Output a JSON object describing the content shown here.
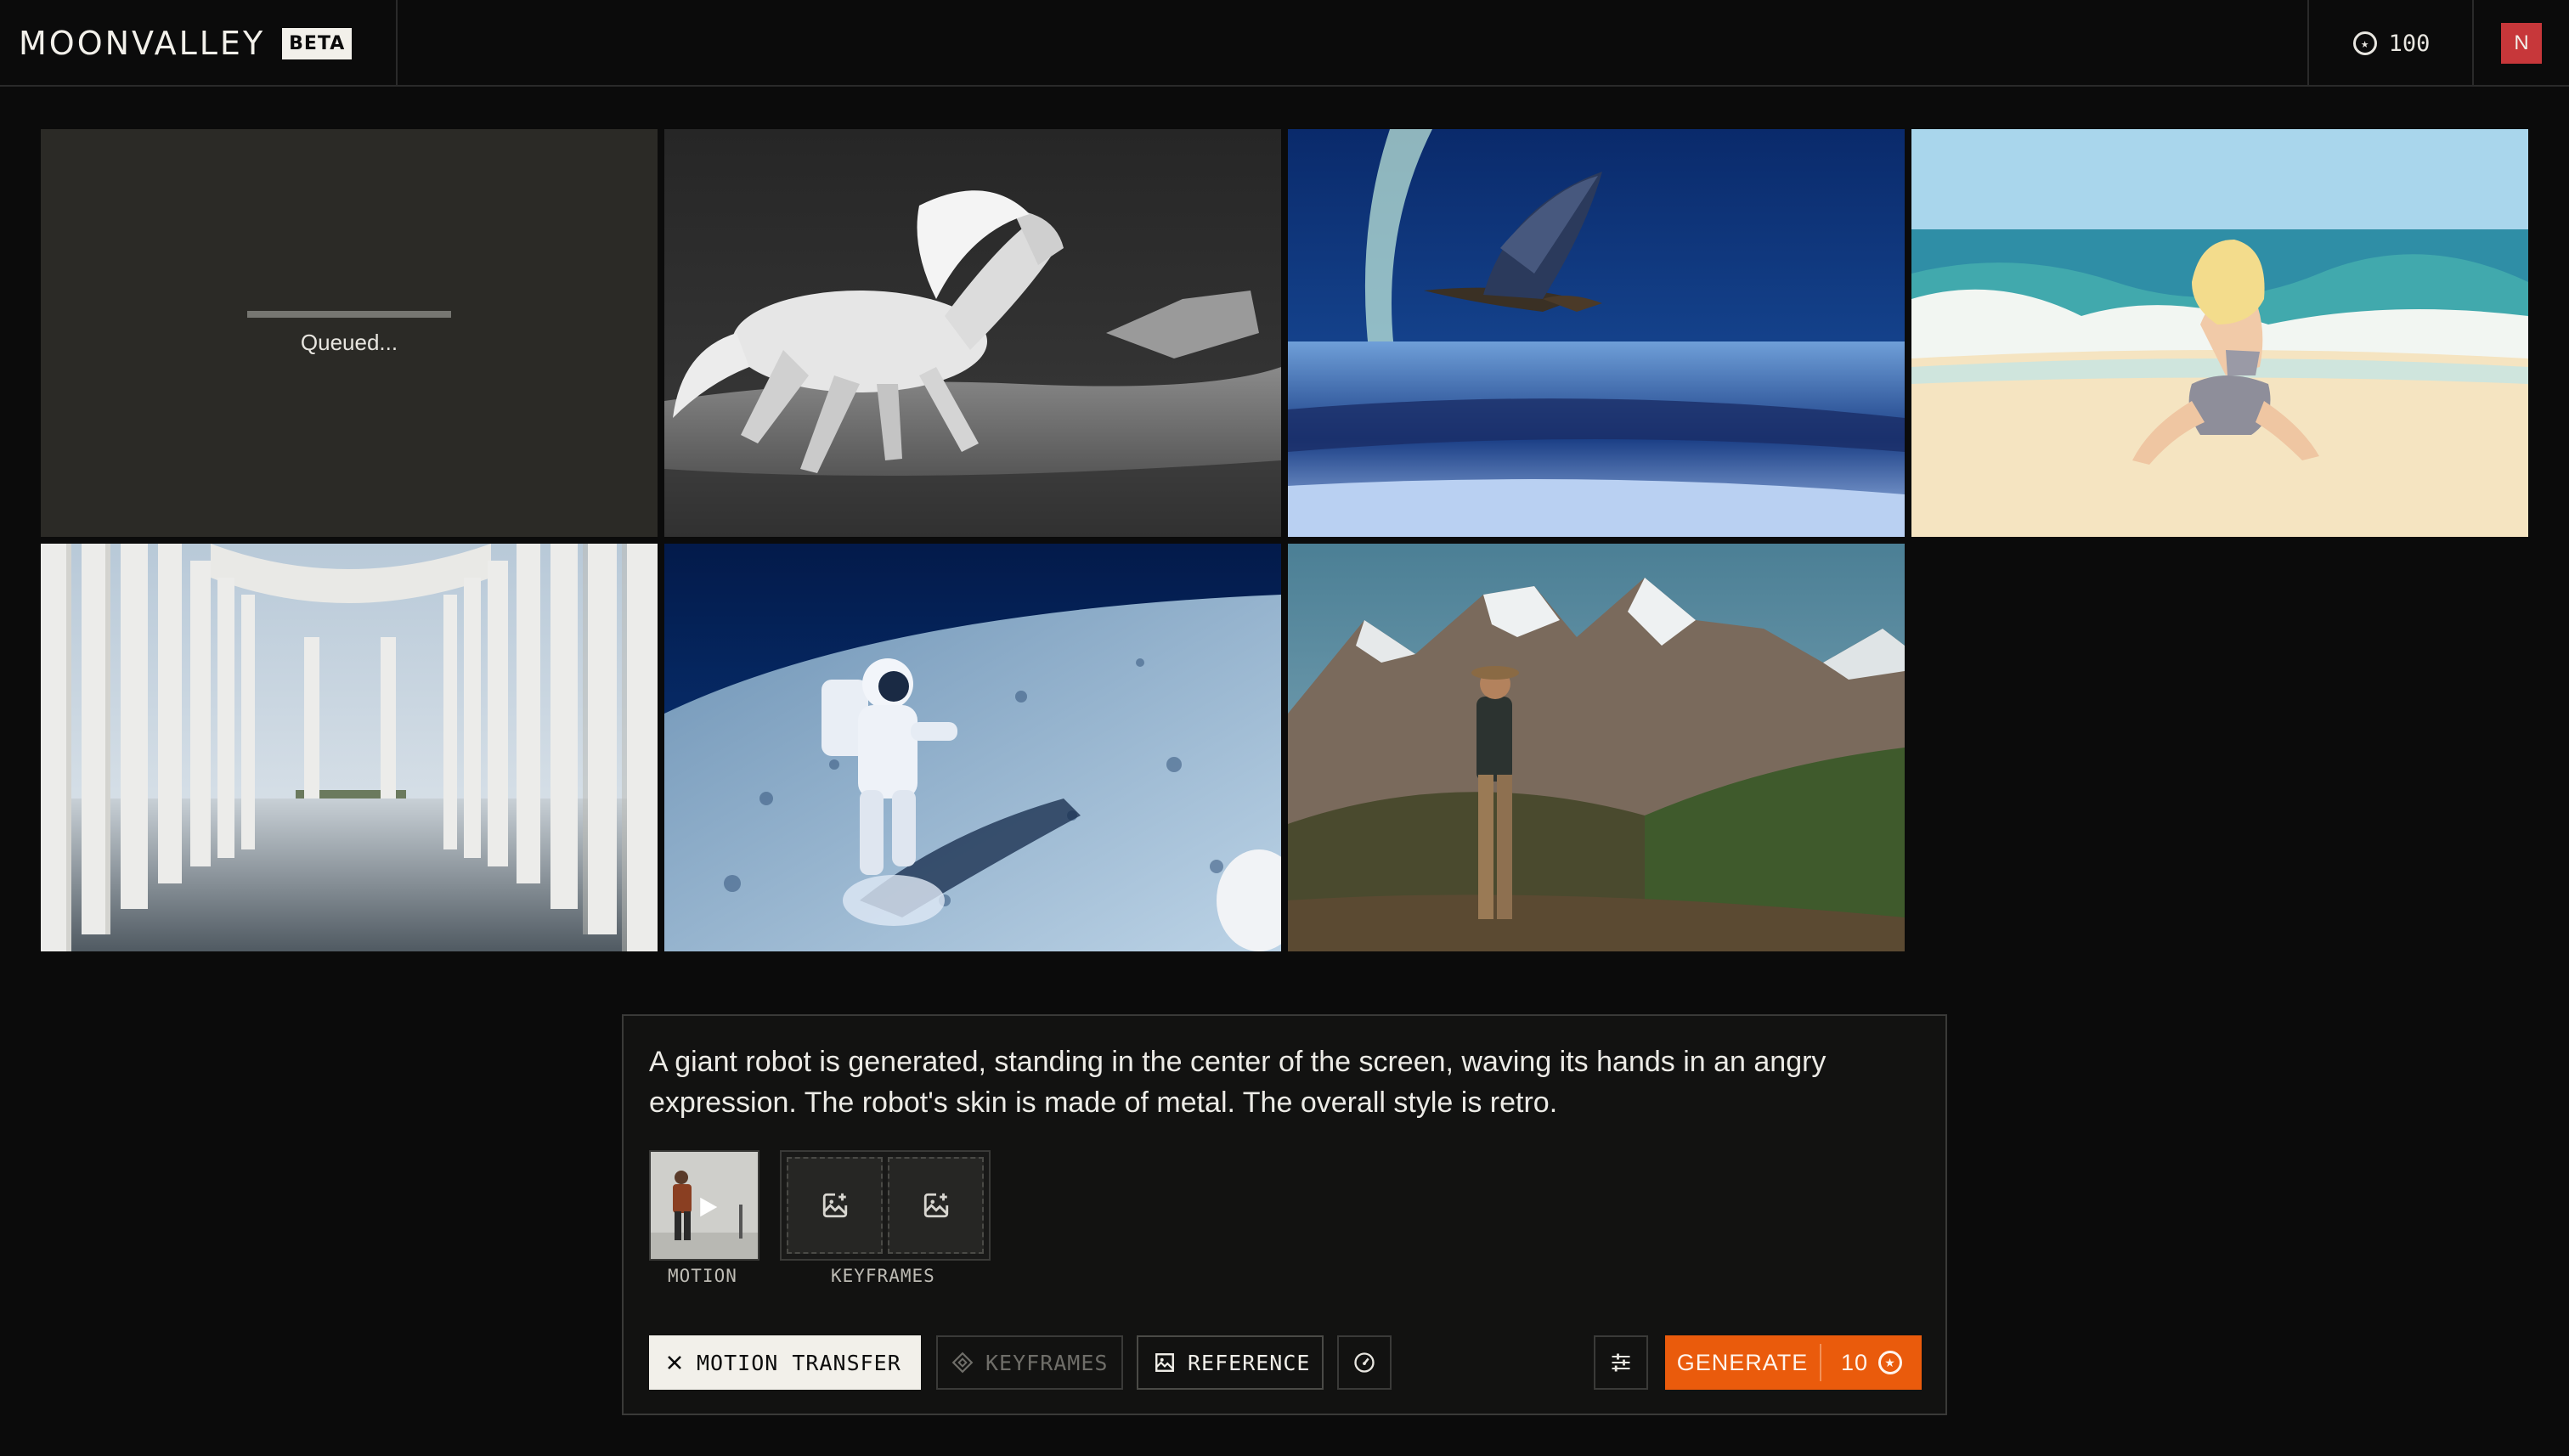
{
  "header": {
    "brand": "MOONVALLEY",
    "badge": "BETA",
    "credits": "100",
    "avatar_initial": "N"
  },
  "gallery": {
    "queued_text": "Queued..."
  },
  "composer": {
    "prompt": "A giant robot is generated, standing in the center of the screen, waving its hands in an angry expression. The robot's skin is made of metal. The overall style is retro.",
    "motion_label": "MOTION",
    "keyframes_label": "KEYFRAMES",
    "motion_transfer_button": "MOTION TRANSFER",
    "keyframes_button": "KEYFRAMES",
    "reference_button": "REFERENCE",
    "generate_button": "GENERATE",
    "generate_cost": "10"
  },
  "colors": {
    "accent": "#ea5b0c",
    "avatar": "#c7373a",
    "background": "#0b0b0b"
  }
}
